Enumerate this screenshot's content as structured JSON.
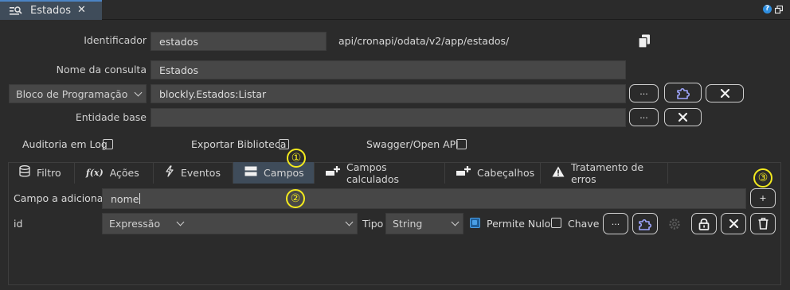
{
  "window": {
    "tab_title": "Estados",
    "tab_icon": "query-icon",
    "close_glyph": "✕",
    "help_glyph": "?",
    "window_icon": "restore-window-icon"
  },
  "form": {
    "identificador_label": "Identificador",
    "identificador_value": "estados",
    "api_path": "api/cronapi/odata/v2/app/estados/",
    "copy_icon": "copy-icon",
    "nome_label": "Nome da consulta",
    "nome_value": "Estados",
    "bloco_select": "Bloco de Programação",
    "bloco_value": "blockly.Estados:Listar",
    "entidade_label": "Entidade base",
    "entidade_value": "",
    "ellipsis": "...",
    "auditoria_label": "Auditoria em Log",
    "exportar_label": "Exportar Biblioteca",
    "swagger_label": "Swagger/Open API"
  },
  "tabs": [
    {
      "label": "Filtro",
      "icon": "database-icon"
    },
    {
      "label": "Ações",
      "icon": "function-icon"
    },
    {
      "label": "Eventos",
      "icon": "lightning-icon"
    },
    {
      "label": "Campos",
      "icon": "fields-icon",
      "active": true
    },
    {
      "label": "Campos calculados",
      "icon": "add-field-icon"
    },
    {
      "label": "Cabeçalhos",
      "icon": "add-header-icon"
    },
    {
      "label": "Tratamento de erros",
      "icon": "warning-icon"
    }
  ],
  "campos": {
    "add_label": "Campo a adicionar",
    "add_value": "nome",
    "add_button": "+",
    "field_name": "id",
    "expression_select": "Expressão",
    "tipo_label": "Tipo",
    "tipo_select": "String",
    "permite_nulo_label": "Permite Nulo",
    "permite_nulo_checked": true,
    "chave_label": "Chave",
    "chave_checked": false
  },
  "markers": [
    "①",
    "②",
    "③"
  ],
  "colors": {
    "background": "#2b2b2b",
    "input": "#474747",
    "active_tab": "#3f4c5a",
    "accent_blue": "#4a9fe6",
    "marker_yellow": "#f3ea1e",
    "plugin_purple": "#9fa6ff"
  }
}
